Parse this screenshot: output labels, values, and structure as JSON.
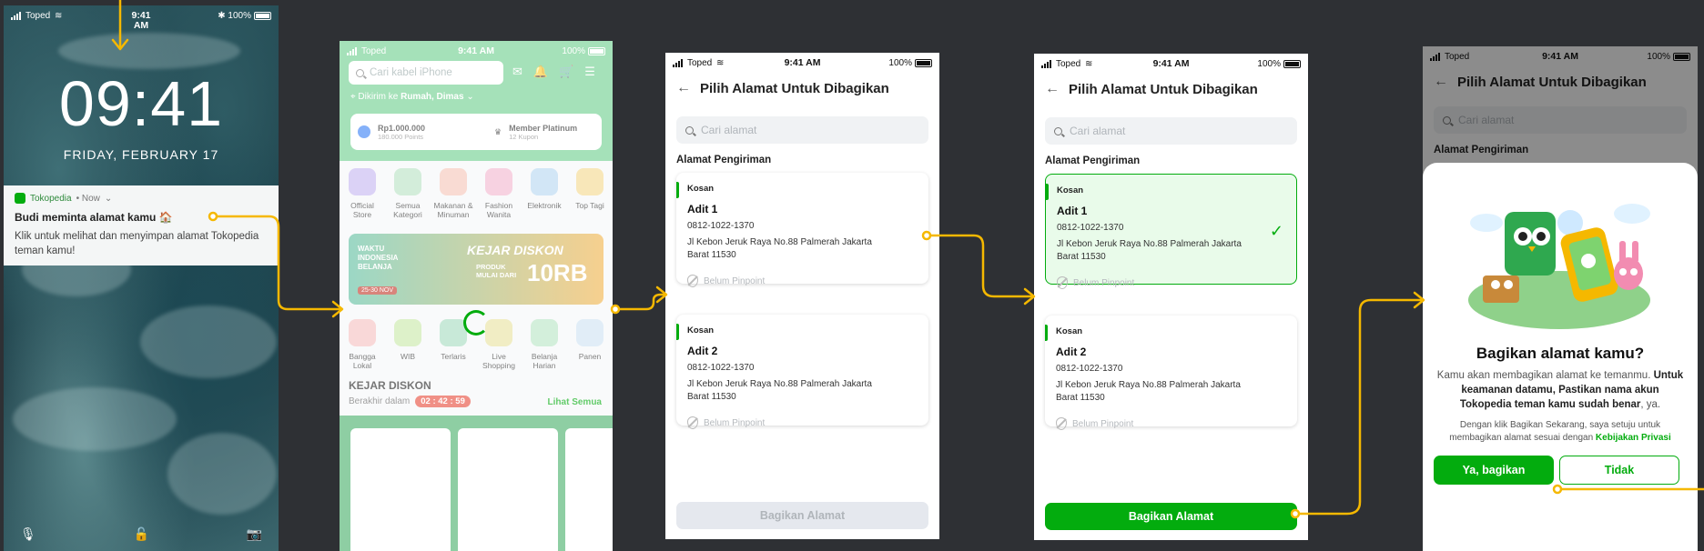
{
  "status": {
    "carrier": "Toped",
    "time": "9:41 AM",
    "time_lock": "9:41\nAM",
    "battery": "100%"
  },
  "lock": {
    "clock": "09:41",
    "date": "FRIDAY, FEBRUARY 17",
    "notification": {
      "app": "Tokopedia",
      "when": "• Now",
      "title": "Budi meminta alamat kamu 🏠",
      "body": "Klik untuk melihat dan menyimpan alamat Tokopedia teman kamu!"
    }
  },
  "home": {
    "search_placeholder": "Cari kabel iPhone",
    "deliver_prefix": "Dikirim ke",
    "deliver_to": "Rumah, Dimas",
    "points_value": "Rp1.000.000",
    "points_sub": "180.000 Points",
    "member": "Member Platinum",
    "member_sub": "12 Kupon",
    "categories": [
      "Official Store",
      "Semua Kategori",
      "Makanan & Minuman",
      "Fashion Wanita",
      "Elektronik",
      "Top Tagi"
    ],
    "banner_left": "WAKTU INDONESIA BELANJA",
    "banner_date": "25-30 NOV",
    "banner_title": "KEJAR DISKON",
    "banner_sub": "PRODUK MULAI DARI",
    "banner_price": "10RB",
    "categories2": [
      "Bangga Lokal",
      "WIB",
      "Terlaris",
      "Live Shopping",
      "Belanja Harian",
      "Panen"
    ],
    "flash_title": "KEJAR DISKON",
    "flash_ends": "Berakhir dalam",
    "flash_timer": "02 : 42 : 59",
    "flash_all": "Lihat Semua"
  },
  "share": {
    "title": "Pilih Alamat Untuk Dibagikan",
    "search_placeholder": "Cari alamat",
    "section": "Alamat Pengiriman",
    "addresses": [
      {
        "tag": "Kosan",
        "name": "Adit 1",
        "phone": "0812-1022-1370",
        "address": "Jl Kebon Jeruk Raya No.88 Palmerah Jakarta Barat 11530",
        "pinpoint": "Belum Pinpoint"
      },
      {
        "tag": "Kosan",
        "name": "Adit 2",
        "phone": "0812-1022-1370",
        "address": "Jl Kebon Jeruk Raya No.88 Palmerah Jakarta Barat 11530",
        "pinpoint": "Belum Pinpoint"
      }
    ],
    "button": "Bagikan Alamat"
  },
  "modal": {
    "title": "Bagikan alamat kamu?",
    "text_a": "Kamu akan membagikan alamat ke temanmu.",
    "text_b": "Untuk keamanan datamu, Pastikan nama akun Tokopedia teman kamu sudah benar",
    "text_c": ", ya.",
    "consent": "Dengan klik Bagikan Sekarang, saya setuju untuk membagikan alamat sesuai dengan",
    "policy": "Kebijakan Privasi",
    "yes": "Ya, bagikan",
    "no": "Tidak"
  },
  "colors": {
    "brand": "#03ac0e",
    "flow": "#f5b800",
    "canvas": "#2e3034"
  }
}
